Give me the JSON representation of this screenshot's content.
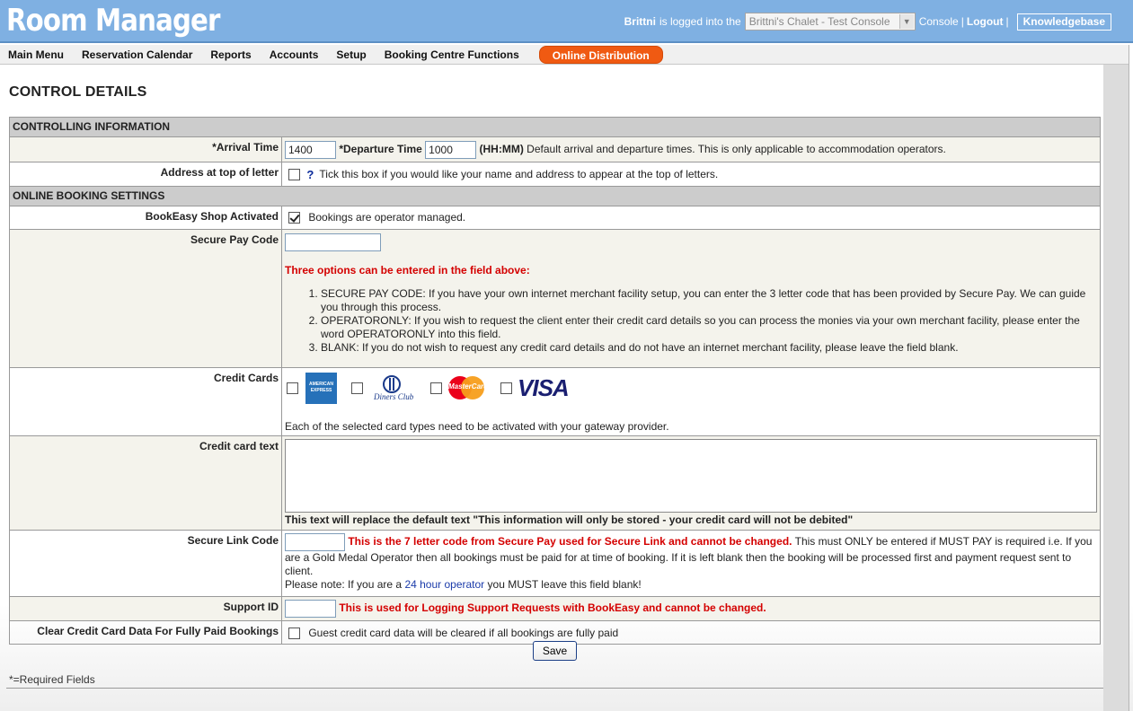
{
  "app": {
    "title": "Room Manager"
  },
  "user_bar": {
    "username": "Brittni",
    "logged_into_text": "is logged into the",
    "console_value": "Brittni's Chalet - Test Console",
    "console_label": "Console",
    "separator": "|",
    "logout_label": "Logout",
    "knowledgebase_label": "Knowledgebase"
  },
  "nav": {
    "items": [
      {
        "label": "Main Menu"
      },
      {
        "label": "Reservation Calendar"
      },
      {
        "label": "Reports"
      },
      {
        "label": "Accounts"
      },
      {
        "label": "Setup"
      },
      {
        "label": "Booking Centre Functions"
      },
      {
        "label": "Online Distribution"
      }
    ]
  },
  "page": {
    "title": "CONTROL DETAILS"
  },
  "sections": {
    "controlling": "CONTROLLING INFORMATION",
    "online_booking": "ONLINE BOOKING SETTINGS"
  },
  "arrival": {
    "label": "*Arrival Time",
    "value": "1400",
    "departure_label": "*Departure Time",
    "departure_value": "1000",
    "format": "(HH:MM)",
    "help": "Default arrival and departure times. This is only applicable to accommodation operators."
  },
  "address_letter": {
    "label": "Address at top of letter",
    "checked": false,
    "help_icon": "?",
    "help": "Tick this box if you would like your name and address to appear at the top of letters."
  },
  "bookeasy_shop": {
    "label": "BookEasy Shop Activated",
    "checked": true,
    "help": "Bookings are operator managed."
  },
  "secure_pay": {
    "label": "Secure Pay Code",
    "value": "",
    "options_heading": "Three options can be entered in the field above:",
    "options": [
      "SECURE PAY CODE: If you have your own internet merchant facility setup, you can enter the 3 letter code that has been provided by Secure Pay. We can guide you through this process.",
      "OPERATORONLY: If you wish to request the client enter their credit card details so you can process the monies via your own merchant facility, please enter the word OPERATORONLY into this field.",
      "BLANK: If you do not wish to request any credit card details and do not have an internet merchant facility, please leave the field blank."
    ]
  },
  "credit_cards": {
    "label": "Credit Cards",
    "cards": [
      {
        "name": "American Express",
        "line1": "AMERICAN",
        "line2": "EXPRESS",
        "checked": false
      },
      {
        "name": "Diners Club",
        "text": "Diners Club",
        "checked": false
      },
      {
        "name": "MasterCard",
        "text": "MasterCard",
        "checked": false
      },
      {
        "name": "VISA",
        "text": "VISA",
        "checked": false
      }
    ],
    "help": "Each of the selected card types need to be activated with your gateway provider.",
    "colors": {
      "amex": "#2671b9",
      "mc_red": "#eb001b",
      "mc_orange": "#f79e1b",
      "visa": "#1a1f71"
    }
  },
  "credit_card_text": {
    "label": "Credit card text",
    "value": "",
    "help": "This text will replace the default text \"This information will only be stored - your credit card will not be debited\""
  },
  "secure_link": {
    "label": "Secure Link Code",
    "value": "",
    "warning": "This is the 7 letter code from Secure Pay used for Secure Link and cannot be changed.",
    "help": "This must ONLY be entered if MUST PAY is required i.e. If you are a Gold Medal Operator then all bookings must be paid for at time of booking. If it is left blank then the booking will be processed first and payment request sent to client.",
    "note_prefix": "Please note: If you are a",
    "note_link": "24 hour operator",
    "note_suffix": "you MUST leave this field blank!"
  },
  "support_id": {
    "label": "Support ID",
    "value": "",
    "warning": "This is used for Logging Support Requests with BookEasy and cannot be changed."
  },
  "clear_cc": {
    "label": "Clear Credit Card Data For Fully Paid Bookings",
    "checked": false,
    "help": "Guest credit card data will be cleared if all bookings are fully paid"
  },
  "actions": {
    "save_label": "Save"
  },
  "footer": {
    "required_note": "*=Required Fields"
  },
  "colors": {
    "header_bg": "#7fb0e2",
    "nav_highlight": "#f05a12",
    "section_bg": "#cccccc",
    "warning_red": "#d40000"
  }
}
